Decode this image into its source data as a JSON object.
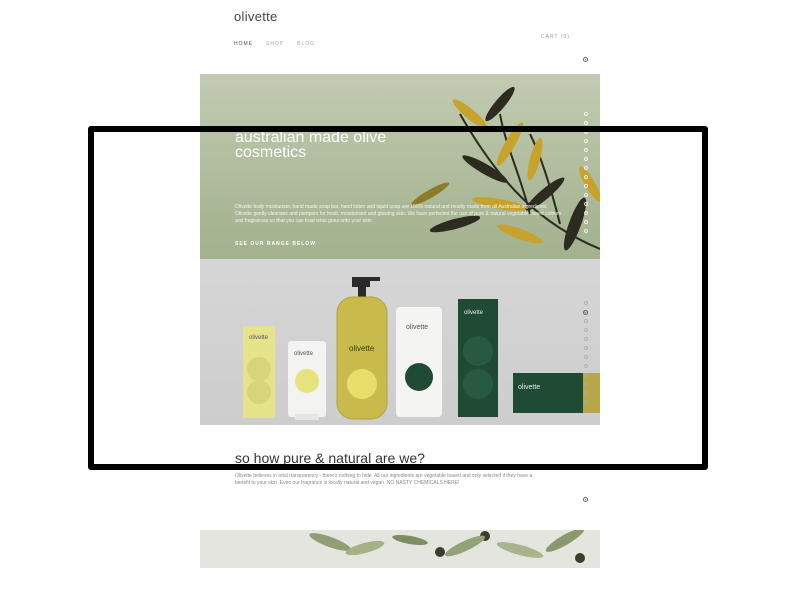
{
  "header": {
    "logo": "olivette",
    "nav": [
      {
        "label": "HOME",
        "active": true
      },
      {
        "label": "SHOP",
        "active": false
      },
      {
        "label": "BLOG",
        "active": false
      }
    ],
    "cart": "CART (0)"
  },
  "hero": {
    "title": "australian made olive cosmetics",
    "text": "Olivette body moisturiser, hand made soap bar, hand lotion and liquid soap are 100% natural and mostly made from all Australian ingredients. Olivette gently cleanses and pampers for fresh, moisturised and glowing skin. We have perfected the use of pure & natural vegetable based colours and fragrances so that you can trust what goes onto your skin.",
    "link": "SEE OUR RANGE BELOW"
  },
  "products": {
    "brand": "olivette",
    "items": [
      "box-yellow",
      "tube-small-white",
      "pump-bottle",
      "tube-large-white",
      "box-green-tall",
      "box-green-flat"
    ]
  },
  "pure": {
    "title": "so how pure & natural are we?",
    "text": "Olivette believes in total transparency - there's nothing to hide. All our ingredients are vegetable based and only selected if they have a benefit to your skin. Even our fragrance is locally natural and vegan. NO NASTY CHEMICALS HERE!"
  },
  "colors": {
    "hero_bg": "#aebb9b",
    "leaf_gold": "#c7a32c",
    "leaf_dark": "#2d2b1f",
    "green_box": "#1f4a34",
    "yellow_box": "#e6e38d",
    "frame": "#000000"
  },
  "icons": [
    "circle-nav-icon"
  ]
}
